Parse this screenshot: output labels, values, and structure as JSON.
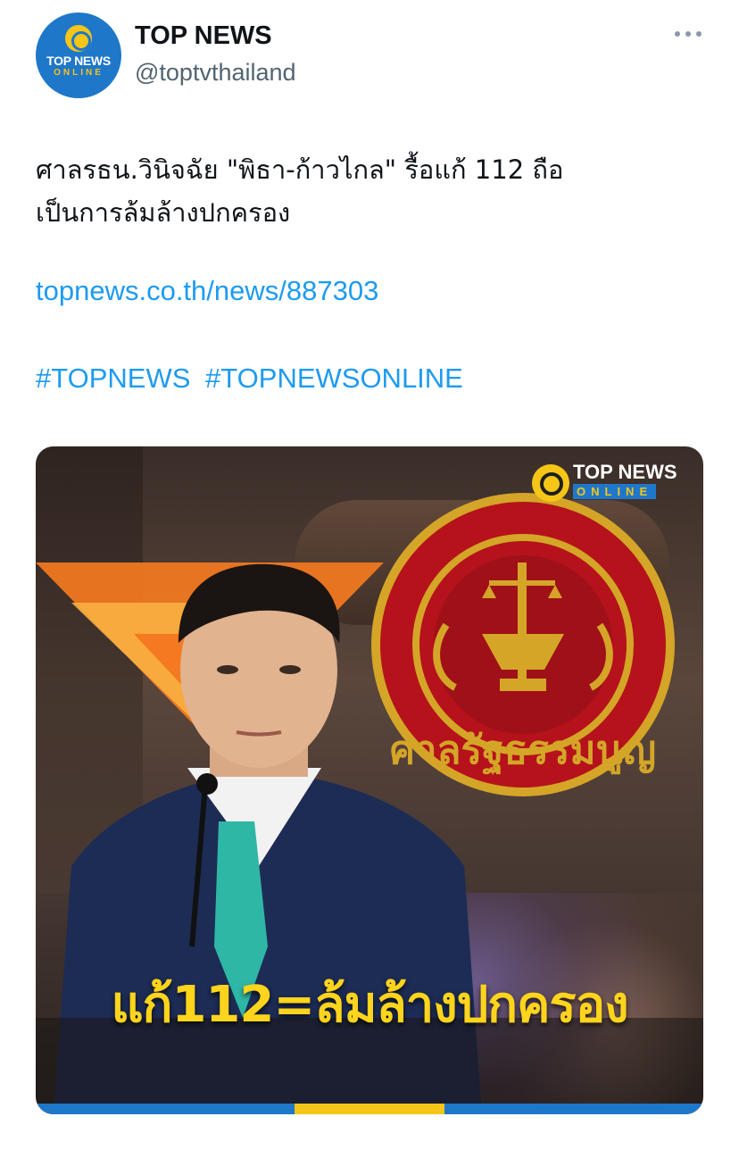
{
  "account": {
    "name": "TOP NEWS",
    "handle": "@toptvthailand",
    "avatar_text_top": "TOP NEWS",
    "avatar_text_bottom": "ONLINE"
  },
  "tweet": {
    "text_line1": "ศาลรธน.วินิจฉัย  \"พิธา-ก้าวไกล\" รื้อแก้ 112 ถือ",
    "text_line2": "เป็นการล้มล้างปกครอง",
    "link": "topnews.co.th/news/887303",
    "hashtags": [
      "#TOPNEWS",
      "#TOPNEWSONLINE"
    ]
  },
  "media": {
    "logo_text_top": "TOP NEWS",
    "logo_text_bottom": "ONLINE",
    "seal_text": "ศาลรัฐธรรมนูญ",
    "headline": "แก้112=ล้มล้างปกครอง"
  },
  "colors": {
    "link": "#1d9bf0",
    "brand_blue": "#1f77c9",
    "brand_yellow": "#f5c518",
    "headline_yellow": "#ffd41c",
    "party_orange": "#f47920",
    "seal_red": "#b5121b",
    "seal_gold": "#d4a527"
  },
  "icons": {
    "more": "more-horizontal-icon"
  }
}
